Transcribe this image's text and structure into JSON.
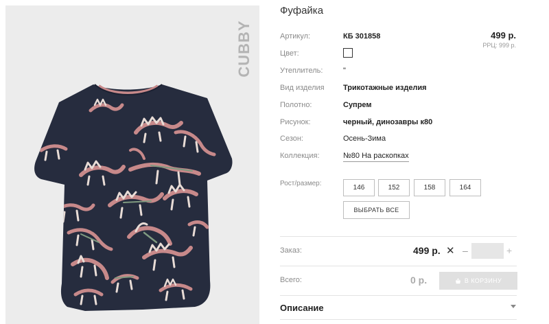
{
  "product": {
    "title": "Фуфайка",
    "brand": "CUBBY",
    "price": "499 р.",
    "rrp": "РРЦ: 999 р."
  },
  "specs": [
    {
      "label": "Артикул:",
      "value": "КБ 301858"
    },
    {
      "label": "Цвет:",
      "value": ""
    },
    {
      "label": "Утеплитель:",
      "value": "\""
    },
    {
      "label": "Вид изделия",
      "value": "Трикотажные изделия"
    },
    {
      "label": "Полотно:",
      "value": "Супрем"
    },
    {
      "label": "Рисунок:",
      "value": "черный, динозавры к80"
    },
    {
      "label": "Сезон:",
      "value": "Осень-Зима"
    },
    {
      "label": "Коллекция:",
      "value": "№80 На раскопках"
    }
  ],
  "sizes": {
    "label": "Рост/размер:",
    "options": [
      "146",
      "152",
      "158",
      "164"
    ],
    "select_all": "ВЫБРАТЬ ВСЕ"
  },
  "order": {
    "label": "Заказ:",
    "price": "499 р.",
    "times": "✕",
    "minus": "–",
    "plus": "+",
    "quantity": ""
  },
  "total": {
    "label": "Всего:",
    "value": "0 р.",
    "cart_button": "В КОРЗИНУ"
  },
  "description": {
    "label": "Описание"
  },
  "colors": {
    "shirt": "#262c3e",
    "dino_pink": "#c7898a",
    "dino_light": "#e8dcd6",
    "dino_green": "#7f9a80",
    "panel_bg": "#ececec"
  }
}
